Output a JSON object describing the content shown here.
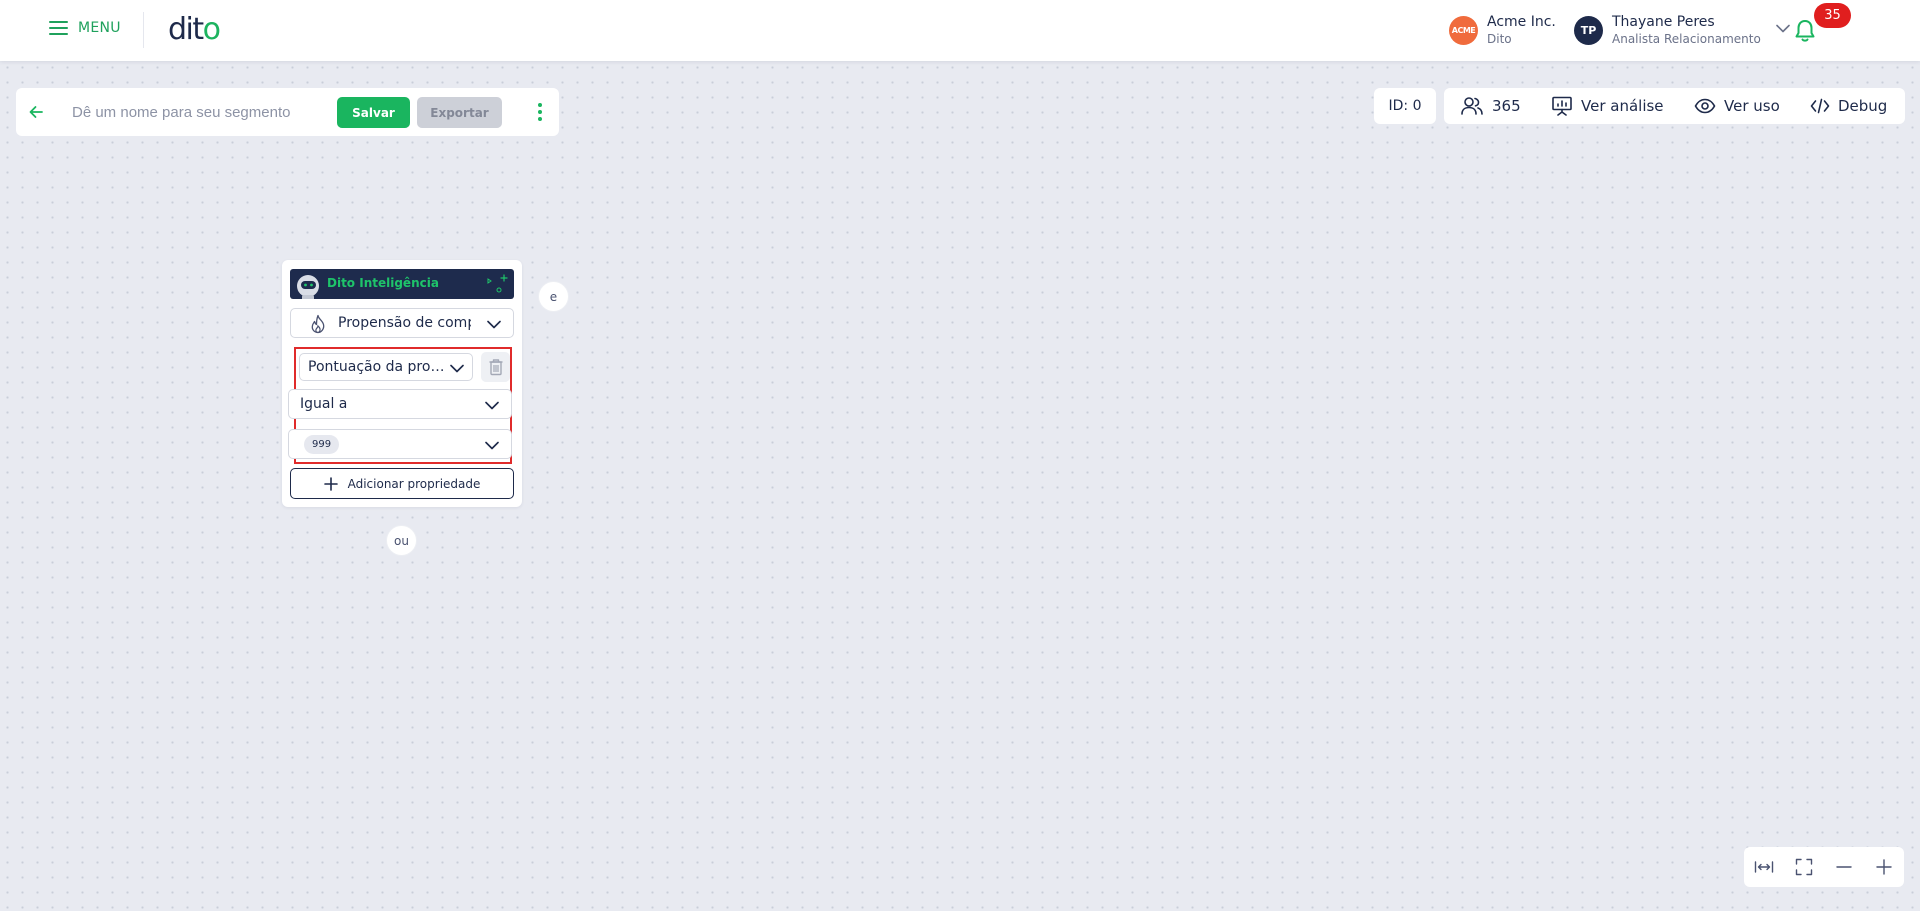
{
  "header": {
    "menu_label": "MENU",
    "logo_text": "dit",
    "logo_dot": "o",
    "company": {
      "logo_text": "ACME",
      "name": "Acme Inc.",
      "sub": "Dito",
      "logo_color": "#f06b3c"
    },
    "user": {
      "initials": "TP",
      "name": "Thayane Peres",
      "role": "Analista Relacionamento"
    },
    "notifications_count": "35"
  },
  "segment": {
    "back_icon": "arrow-left-icon",
    "name_value": "",
    "name_placeholder": "Dê um nome para seu segmento",
    "save_label": "Salvar",
    "export_label": "Exportar",
    "more_icon": "kebab-vertical-icon"
  },
  "topright": {
    "id_label": "ID: 0",
    "audience_count": "365",
    "analysis_label": "Ver análise",
    "usage_label": "Ver uso",
    "debug_label": "Debug"
  },
  "node": {
    "header_title": "Dito Inteligência",
    "model_value": "Propensão de compra",
    "property_value": "Pontuação da propensão",
    "operator_value": "Igual a",
    "value_chip": "999",
    "add_property_label": "Adicionar propriedade"
  },
  "connectors": {
    "and": "e",
    "or": "ou"
  },
  "zoom": {
    "fit_icon": "fit-width-icon",
    "fullscreen_icon": "fullscreen-icon",
    "zoom_out_icon": "minus-icon",
    "zoom_in_icon": "plus-icon"
  },
  "colors": {
    "brand_green": "#1ab55f",
    "navy": "#1e2a4a",
    "alert_red": "#e01e1e",
    "highlight_border": "#e02b2b"
  }
}
